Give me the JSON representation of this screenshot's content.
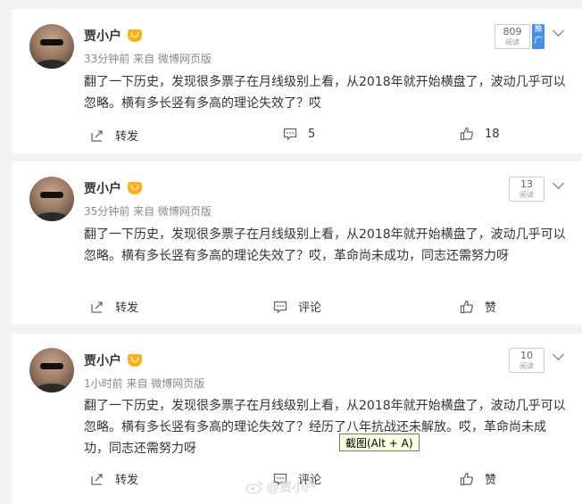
{
  "posts": [
    {
      "author": "贾小户",
      "meta": "33分钟前 来自 微博网页版",
      "content": "翻了一下历史，发现很多票子在月线级别上看，从2018年就开始横盘了，波动几乎可以忽略。横有多长竖有多高的理论失效了？哎",
      "reads": "809",
      "reads_label": "阅读",
      "promo_label": "推广",
      "repost_label": "转发",
      "comment_label": "5",
      "like_label": "18"
    },
    {
      "author": "贾小户",
      "meta": "35分钟前 来自 微博网页版",
      "content": "翻了一下历史，发现很多票子在月线级别上看，从2018年就开始横盘了，波动几乎可以忽略。横有多长竖有多高的理论失效了？哎，革命尚未成功，同志还需努力呀",
      "reads": "13",
      "reads_label": "阅读",
      "repost_label": "转发",
      "comment_label": "评论",
      "like_label": "赞"
    },
    {
      "author": "贾小户",
      "meta": "1小时前 来自 微博网页版",
      "content": "翻了一下历史，发现很多票子在月线级别上看，从2018年就开始横盘了，波动几乎可以忽略。横有多长竖有多高的理论失效了？经历了八年抗战还未解放。哎，革命尚未成功，同志还需努力呀",
      "reads": "10",
      "reads_label": "阅读",
      "repost_label": "转发",
      "comment_label": "评论",
      "like_label": "赞"
    }
  ],
  "tooltip": "截图(Alt + A)",
  "watermark": "@贾小户",
  "icons": {
    "repost": "share-icon",
    "comment": "comment-icon",
    "like": "thumbs-up-icon",
    "vip": "crown-badge-icon",
    "menu": "chevron-down-icon"
  },
  "colors": {
    "accent": "#4a90e2",
    "vip": "#ffb11b"
  }
}
